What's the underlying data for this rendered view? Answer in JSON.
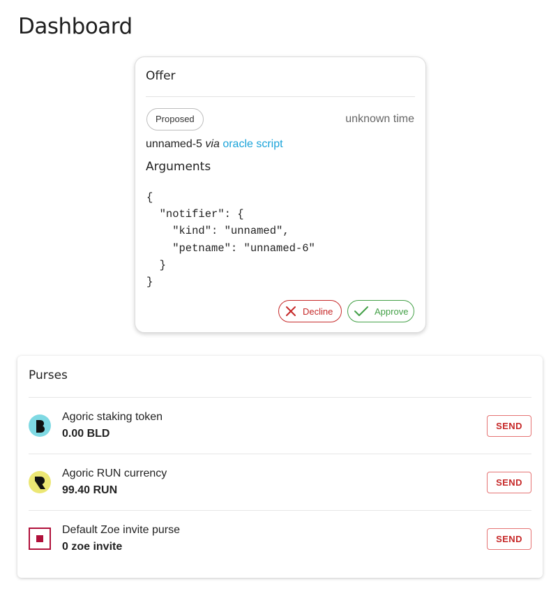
{
  "page": {
    "title": "Dashboard"
  },
  "offer": {
    "title": "Offer",
    "status": "Proposed",
    "time": "unknown time",
    "origin_name": "unnamed-5",
    "via": "via",
    "origin_link": "oracle script",
    "arguments_heading": "Arguments",
    "arguments_code": "{\n  \"notifier\": {\n    \"kind\": \"unnamed\",\n    \"petname\": \"unnamed-6\"\n  }\n}",
    "decline_label": "Decline",
    "approve_label": "Approve"
  },
  "purses": {
    "title": "Purses",
    "items": [
      {
        "name": "Agoric staking token",
        "balance": "0.00 BLD",
        "icon": "bld-token-icon",
        "icon_color": "#7fd9e3",
        "send_label": "SEND"
      },
      {
        "name": "Agoric RUN currency",
        "balance": "99.40 RUN",
        "icon": "run-token-icon",
        "icon_color": "#ece774",
        "send_label": "SEND"
      },
      {
        "name": "Default Zoe invite purse",
        "balance": "0 zoe invite",
        "icon": "zoe-invite-icon",
        "icon_color": "#b0103a",
        "send_label": "SEND"
      }
    ]
  },
  "colors": {
    "decline": "#c62828",
    "approve": "#43a047",
    "link": "#1aa3d9",
    "send": "#c62828"
  }
}
